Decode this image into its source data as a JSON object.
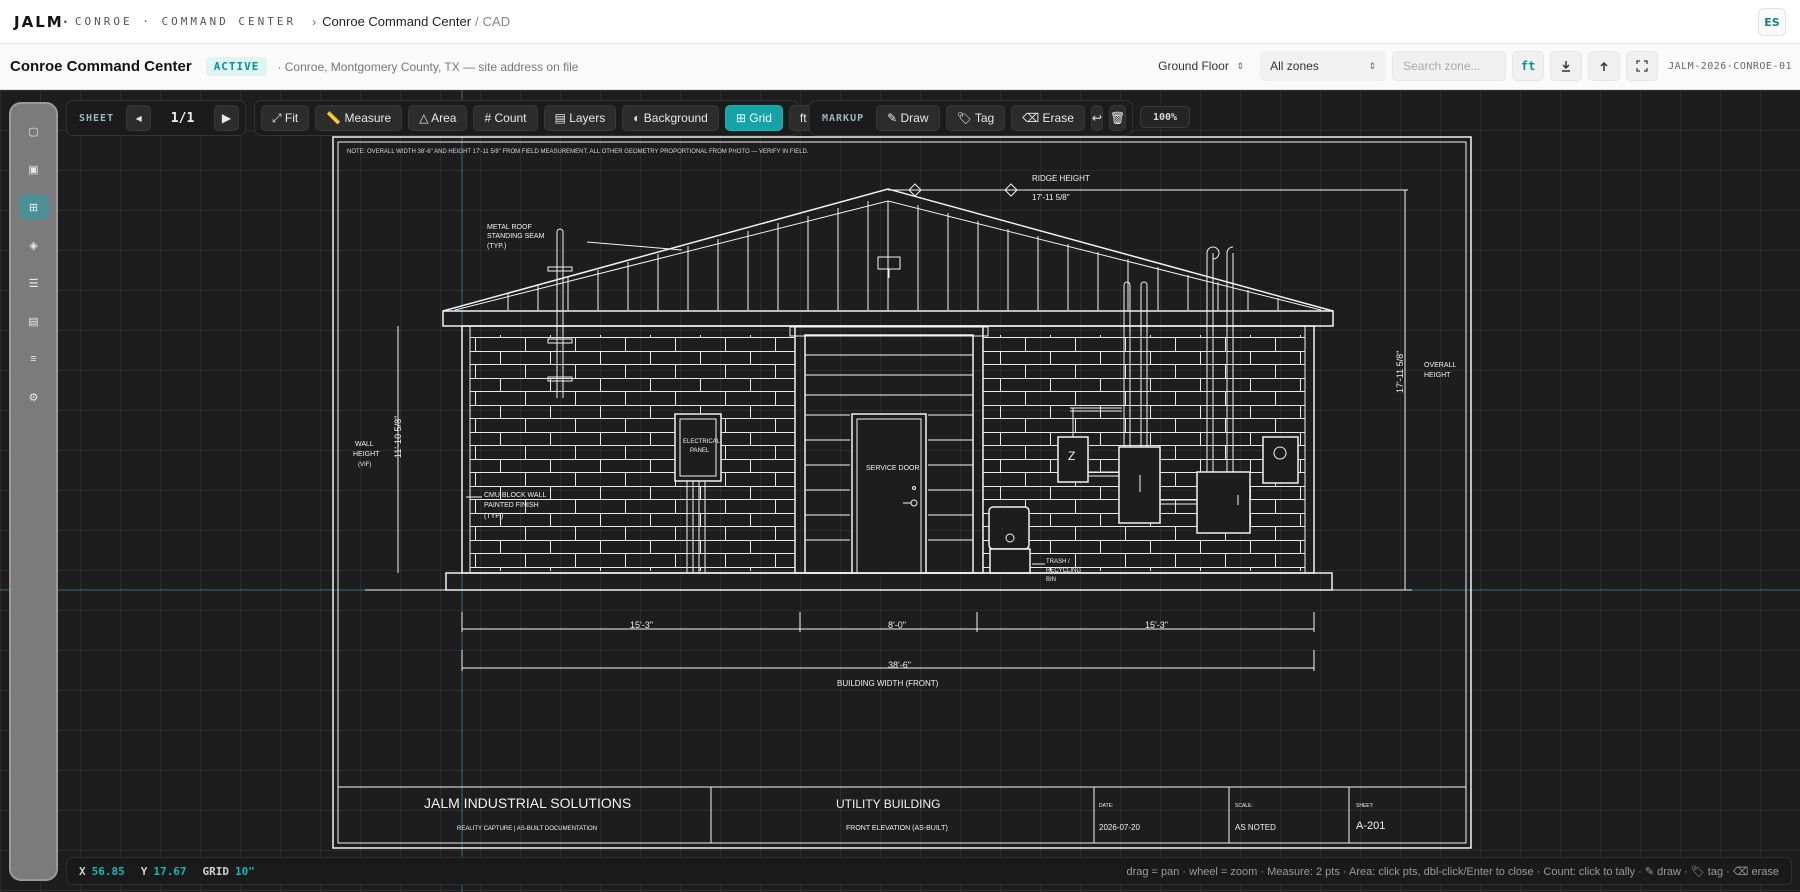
{
  "topnav": {
    "brand": "JALM",
    "brand_dot": "•",
    "brand_sub": "CONROE · COMMAND CENTER",
    "crumb_sep": "›",
    "crumb_main": "Conroe Command Center",
    "crumb_slash": "/",
    "crumb_sub": "CAD",
    "avatar": "ES"
  },
  "header": {
    "title": "Conroe Command Center",
    "status_badge": "ACTIVE",
    "location": "· Conroe, Montgomery County, TX — site address on file",
    "floor_select": "Ground Floor",
    "zones_select": "All zones",
    "search_placeholder": "Search zone...",
    "unit_button": "ft",
    "doc_id": "JALM-2026-CONROE-01"
  },
  "toolbar": {
    "sheet_label": "SHEET",
    "page": "1/1",
    "fit": "⤢ Fit",
    "measure": "📏 Measure",
    "area": "△ Area",
    "count": "# Count",
    "layers": "▤ Layers",
    "background": "◐ Background",
    "grid": "⊞ Grid",
    "units": "ft ⇄ m",
    "markup_label": "MARKUP",
    "draw": "✎ Draw",
    "tag": "🏷 Tag",
    "erase": "⌫ Erase",
    "undo": "↩",
    "trash": "🗑",
    "zoom": "100%"
  },
  "status": {
    "x_label": "X",
    "x_value": "56.85",
    "y_label": "Y",
    "y_value": "17.67",
    "grid_label": "GRID",
    "grid_value": "10\"",
    "help": "drag = pan · wheel = zoom · Measure: 2 pts · Area: click pts, dbl-click/Enter to close · Count: click to tally · ✎ draw · 🏷 tag · ⌫ erase"
  },
  "drawing": {
    "note": "NOTE: OVERALL WIDTH 38'-6\" AND HEIGHT 17'-11 5/8\" FROM FIELD MEASUREMENT. ALL OTHER GEOMETRY PROPORTIONAL FROM PHOTO — VERIFY IN FIELD.",
    "ridge_label": "RIDGE HEIGHT",
    "ridge_dim": "17'-11 5/8\"",
    "roof_label_1": "METAL ROOF",
    "roof_label_2": "STANDING SEAM",
    "roof_label_3": "(TYP.)",
    "overall_dim": "17'-11 5/8\"",
    "overall_label_1": "OVERALL",
    "overall_label_2": "HEIGHT",
    "wall_dim": "11'-10 5/8\"",
    "wall_label_1": "WALL",
    "wall_label_2": "HEIGHT",
    "wall_label_3": "(VIF)",
    "panel_label_1": "ELECTRICAL",
    "panel_label_2": "PANEL",
    "door_label": "SERVICE DOOR",
    "cmu_label_1": "CMU BLOCK WALL",
    "cmu_label_2": "PAINTED FINISH",
    "cmu_label_3": "(TYP.)",
    "bin_label_1": "TRASH /",
    "bin_label_2": "RECYCLING",
    "bin_label_3": "BIN",
    "meter_letter": "Z",
    "dim_left": "15'-3\"",
    "dim_mid": "8'-0\"",
    "dim_right": "15'-3\"",
    "dim_total": "38'-6\"",
    "width_label": "BUILDING WIDTH (FRONT)",
    "tb_company": "JALM INDUSTRIAL SOLUTIONS",
    "tb_company_sub": "REALITY CAPTURE | AS-BUILT DOCUMENTATION",
    "tb_project": "UTILITY BUILDING",
    "tb_project_sub": "FRONT ELEVATION (AS-BUILT)",
    "tb_date_label": "DATE:",
    "tb_date": "2026-07-20",
    "tb_scale_label": "SCALE:",
    "tb_scale": "AS NOTED",
    "tb_sheet_label": "SHEET:",
    "tb_sheet": "A-201"
  },
  "colors": {
    "accent": "#16a2a6",
    "badge_bg": "#dff4f3",
    "canvas": "#1d1d1d",
    "line": "#f2f2f2"
  }
}
